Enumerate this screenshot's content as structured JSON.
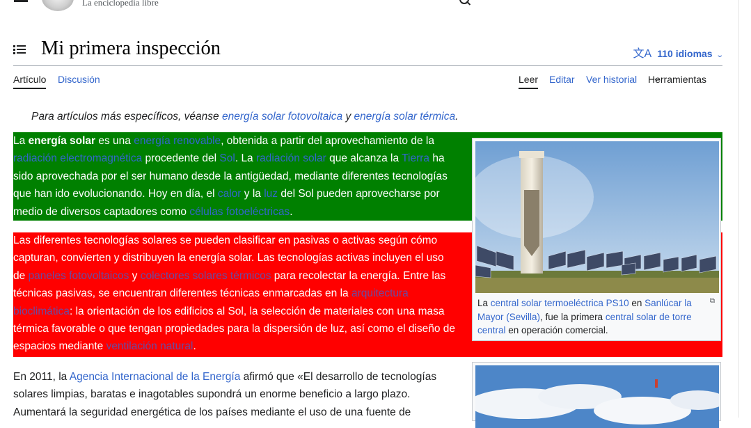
{
  "header": {
    "tagline": "La enciclopedia libre"
  },
  "page": {
    "title": "Mi primera inspección",
    "languages": "110 idiomas"
  },
  "tabs": {
    "article": "Artículo",
    "talk": "Discusión",
    "read": "Leer",
    "edit": "Editar",
    "history": "Ver historial",
    "tools": "Herramientas"
  },
  "hatnote": {
    "prefix": "Para artículos más específicos, véanse ",
    "link1": "energía solar fotovoltaica",
    "mid": " y ",
    "link2": "energía solar térmica",
    "end": "."
  },
  "paragraph1": [
    {
      "t": "La "
    },
    {
      "t": "energía solar",
      "b": true
    },
    {
      "t": " es una "
    },
    {
      "t": "energía renovable",
      "l": "dim"
    },
    {
      "t": ", obtenida a partir del aprovechamiento de la "
    },
    {
      "t": "radiación electromagnética",
      "l": "dim"
    },
    {
      "t": " procedente del "
    },
    {
      "t": "Sol",
      "l": "dim"
    },
    {
      "t": ". La "
    },
    {
      "t": "radiación solar",
      "l": "dim"
    },
    {
      "t": " que alcanza la "
    },
    {
      "t": "Tierra",
      "l": "dim"
    },
    {
      "t": " ha sido aprovechada por el ser humano desde la antigüedad, mediante diferentes tecnologías que han ido evolucionando. Hoy en día, el "
    },
    {
      "t": "calor",
      "l": "dim"
    },
    {
      "t": " y la "
    },
    {
      "t": "luz",
      "l": "dim"
    },
    {
      "t": " del Sol pueden aprovecharse por medio de diversos captadores como "
    },
    {
      "t": "células fotoeléctricas",
      "l": "dim"
    },
    {
      "t": "."
    }
  ],
  "paragraph2": [
    {
      "t": "Las diferentes tecnologías solares se pueden clasificar en pasivas o activas según cómo capturan, convierten y distribuyen la energía solar. Las tecnologías activas incluyen el uso de "
    },
    {
      "t": "paneles fotovoltaicos",
      "l": "purple"
    },
    {
      "t": " y "
    },
    {
      "t": "colectores solares térmicos",
      "l": "purple"
    },
    {
      "t": " para recolectar la energía. Entre las técnicas pasivas, se encuentran diferentes técnicas enmarcadas en la "
    },
    {
      "t": "arquitectura bioclimática",
      "l": "purple"
    },
    {
      "t": ": la orientación de los edificios al Sol, la selección de materiales con una masa térmica favorable o que tengan propiedades para la dispersión de luz, así como el diseño de espacios mediante "
    },
    {
      "t": "ventilación natural",
      "l": "purple"
    },
    {
      "t": "."
    }
  ],
  "paragraph3": [
    {
      "t": "En 2011, la "
    },
    {
      "t": "Agencia Internacional de la Energía",
      "l": "blue"
    },
    {
      "t": " afirmó que «El desarrollo de tecnologías solares limpias, baratas e inagotables supondrá un enorme beneficio a largo plazo. Aumentará la seguridad energética de los países mediante el uso de una fuente de"
    }
  ],
  "caption": [
    {
      "t": "La "
    },
    {
      "t": "central solar termoeléctrica PS10",
      "l": "blue"
    },
    {
      "t": " en "
    },
    {
      "t": "Sanlúcar la Mayor (Sevilla)",
      "l": "blue"
    },
    {
      "t": ", fue la primera "
    },
    {
      "t": "central solar de torre central",
      "l": "blue"
    },
    {
      "t": " en operación comercial."
    }
  ],
  "colors": {
    "green_bg": "#008000",
    "red_bg": "#ff0000",
    "link": "#3366cc",
    "dim_link": "#36c",
    "purple_link": "#6b4ba1"
  }
}
